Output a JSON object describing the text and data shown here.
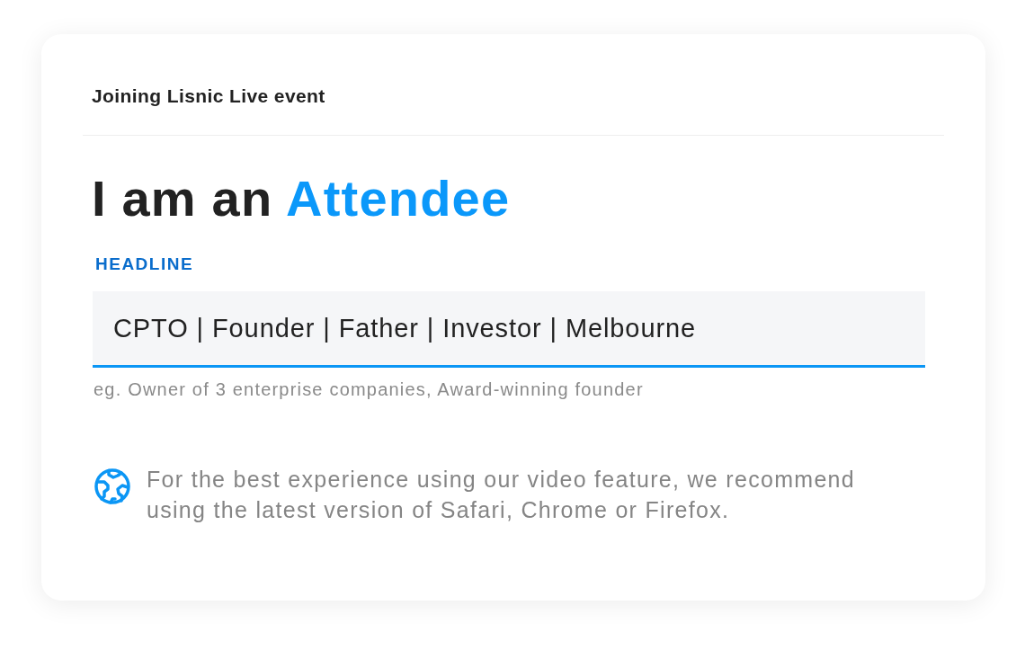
{
  "header": {
    "title": "Joining Lisnic Live event"
  },
  "heading": {
    "text": "I am an",
    "highlight": "Attendee"
  },
  "field": {
    "label": "HEADLINE",
    "value": "CPTO | Founder | Father | Investor | Melbourne",
    "focused": true,
    "hint": "eg. Owner of 3 enterprise companies, Award-winning founder"
  },
  "notice": {
    "text": "For the best experience using our video feature, we recommend using the latest version of Safari, Chrome or Firefox."
  }
}
